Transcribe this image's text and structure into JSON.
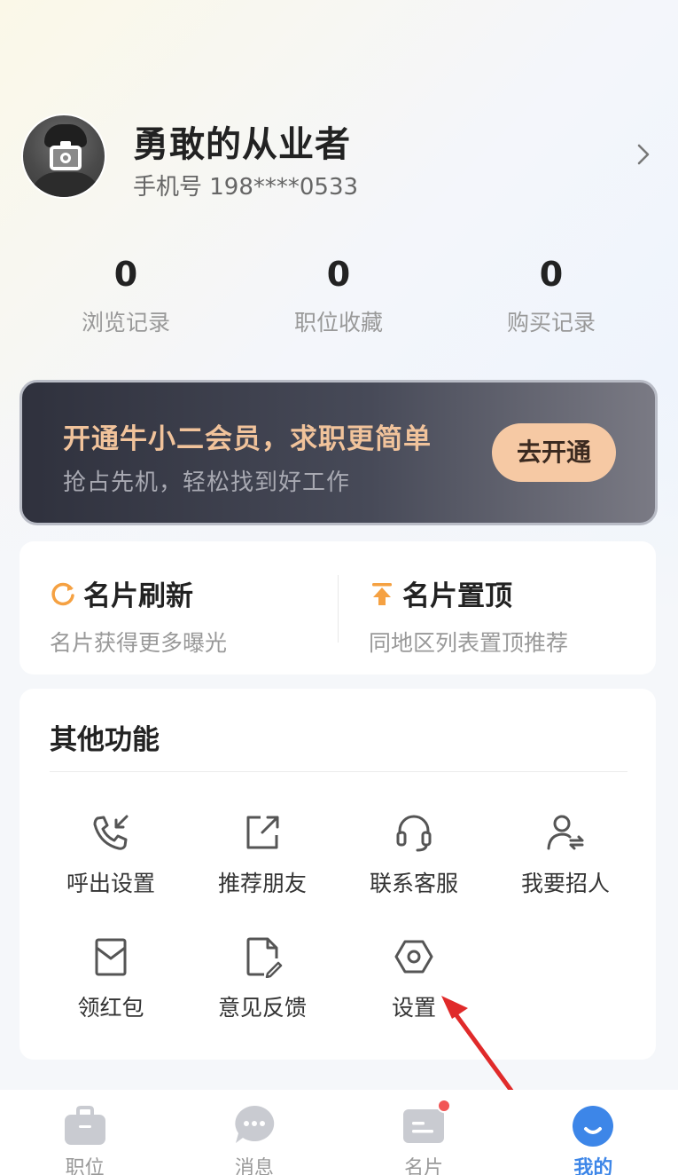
{
  "profile": {
    "name": "勇敢的从业者",
    "phone": "手机号 198****0533"
  },
  "stats": [
    {
      "value": "0",
      "label": "浏览记录"
    },
    {
      "value": "0",
      "label": "职位收藏"
    },
    {
      "value": "0",
      "label": "购买记录"
    }
  ],
  "vip": {
    "title": "开通牛小二会员，求职更简单",
    "subtitle": "抢占先机，轻松找到好工作",
    "button": "去开通"
  },
  "promote": {
    "refresh": {
      "title": "名片刷新",
      "subtitle": "名片获得更多曝光"
    },
    "top": {
      "title": "名片置顶",
      "subtitle": "同地区列表置顶推荐"
    }
  },
  "functions": {
    "title": "其他功能",
    "items": [
      {
        "label": "呼出设置",
        "icon": "phone-outgoing-icon"
      },
      {
        "label": "推荐朋友",
        "icon": "share-icon"
      },
      {
        "label": "联系客服",
        "icon": "headset-icon"
      },
      {
        "label": "我要招人",
        "icon": "recruit-icon"
      },
      {
        "label": "领红包",
        "icon": "red-envelope-icon"
      },
      {
        "label": "意见反馈",
        "icon": "feedback-icon"
      },
      {
        "label": "设置",
        "icon": "settings-icon"
      }
    ]
  },
  "tabs": [
    {
      "label": "职位",
      "icon": "briefcase-icon",
      "active": false
    },
    {
      "label": "消息",
      "icon": "message-icon",
      "active": false
    },
    {
      "label": "名片",
      "icon": "card-icon",
      "active": false,
      "badge": true
    },
    {
      "label": "我的",
      "icon": "profile-smile-icon",
      "active": true
    }
  ],
  "colors": {
    "accent": "#3d86e8",
    "vip_gold": "#f1c39b",
    "vip_button": "#f6c9a4",
    "badge": "#f25656",
    "icon_orange": "#f5a142",
    "annotation_red": "#e02a2a"
  }
}
